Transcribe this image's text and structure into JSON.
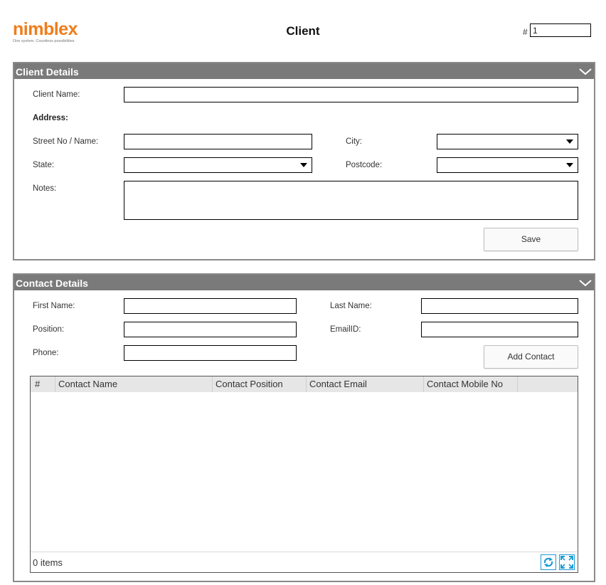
{
  "header": {
    "logo_text": "nimblex",
    "logo_tagline": "One system. Countless possibilities",
    "title": "Client",
    "id_label": "#",
    "id_value": "1"
  },
  "client_details": {
    "title": "Client Details",
    "client_name_label": "Client Name:",
    "address_label": "Address:",
    "street_label": "Street No / Name:",
    "city_label": "City:",
    "state_label": "State:",
    "postcode_label": "Postcode:",
    "notes_label": "Notes:",
    "client_name_value": "",
    "street_value": "",
    "city_value": "",
    "state_value": "",
    "postcode_value": "",
    "notes_value": "",
    "save_label": "Save"
  },
  "contact_details": {
    "title": "Contact Details",
    "first_name_label": "First Name:",
    "last_name_label": "Last Name:",
    "position_label": "Position:",
    "email_label": "EmailID:",
    "phone_label": "Phone:",
    "first_name_value": "",
    "last_name_value": "",
    "position_value": "",
    "email_value": "",
    "phone_value": "",
    "add_contact_label": "Add Contact"
  },
  "contacts_grid": {
    "columns": [
      "#",
      "Contact Name",
      "Contact Position",
      "Contact Email",
      "Contact Mobile No"
    ],
    "rows": [],
    "items_text": "0 items",
    "icons": [
      "refresh-icon",
      "expand-icon"
    ],
    "accent": "#1a9ad6"
  },
  "colors": {
    "brand_orange": "#ef7d1b",
    "panel_header": "#7a7a7a"
  }
}
